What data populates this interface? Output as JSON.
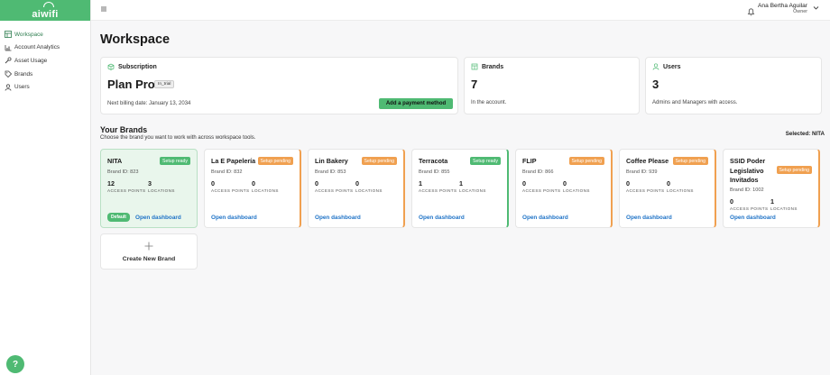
{
  "app": {
    "logo_text": "aiwifi",
    "brand_color": "#4fba73"
  },
  "sidebar": {
    "items": [
      {
        "label": "Workspace",
        "icon": "grid-icon",
        "active": true
      },
      {
        "label": "Account Analytics",
        "icon": "bar-chart-icon",
        "active": false
      },
      {
        "label": "Asset Usage",
        "icon": "wrench-icon",
        "active": false
      },
      {
        "label": "Brands",
        "icon": "tag-icon",
        "active": false
      },
      {
        "label": "Users",
        "icon": "user-icon",
        "active": false
      }
    ],
    "help_label": "?"
  },
  "topbar": {
    "user_name": "Ana Bertha Aguilar",
    "user_role": "Owner"
  },
  "page": {
    "title": "Workspace",
    "subscription": {
      "header": "Subscription",
      "plan": "Plan Pro",
      "badge": "In_trial",
      "billing": "Next billing date: January 13, 2034",
      "action": "Add a payment method"
    },
    "brands_stat": {
      "header": "Brands",
      "value": "7",
      "caption": "In the account."
    },
    "users_stat": {
      "header": "Users",
      "value": "3",
      "caption": "Admins and Managers with access."
    },
    "your_brands": {
      "title": "Your Brands",
      "description": "Choose the brand you want to work with across workspace tools.",
      "selected": "Selected: NITA"
    },
    "brands": [
      {
        "name": "NITA",
        "status": "Setup ready",
        "id": "Brand ID: 823",
        "ap": "12",
        "loc": "3",
        "default": "Default",
        "open": "Open dashboard"
      },
      {
        "name": "La E Papelería",
        "status": "Setup pending",
        "id": "Brand ID: 832",
        "ap": "0",
        "loc": "0",
        "open": "Open dashboard"
      },
      {
        "name": "Lin Bakery",
        "status": "Setup pending",
        "id": "Brand ID: 853",
        "ap": "0",
        "loc": "0",
        "open": "Open dashboard"
      },
      {
        "name": "Terracota",
        "status": "Setup ready",
        "id": "Brand ID: 855",
        "ap": "1",
        "loc": "1",
        "open": "Open dashboard"
      },
      {
        "name": "FLIP",
        "status": "Setup pending",
        "id": "Brand ID: 866",
        "ap": "0",
        "loc": "0",
        "open": "Open dashboard"
      },
      {
        "name": "Coffee Please",
        "status": "Setup pending",
        "id": "Brand ID: 939",
        "ap": "0",
        "loc": "0",
        "open": "Open dashboard"
      },
      {
        "name": "SSID Poder Legislativo Invitados",
        "status": "Setup pending",
        "id": "Brand ID: 1002",
        "ap": "0",
        "loc": "1",
        "open": "Open dashboard"
      }
    ],
    "access_points_label": "ACCESS POINTS",
    "locations_label": "LOCATIONS",
    "create_label": "Create New Brand"
  }
}
